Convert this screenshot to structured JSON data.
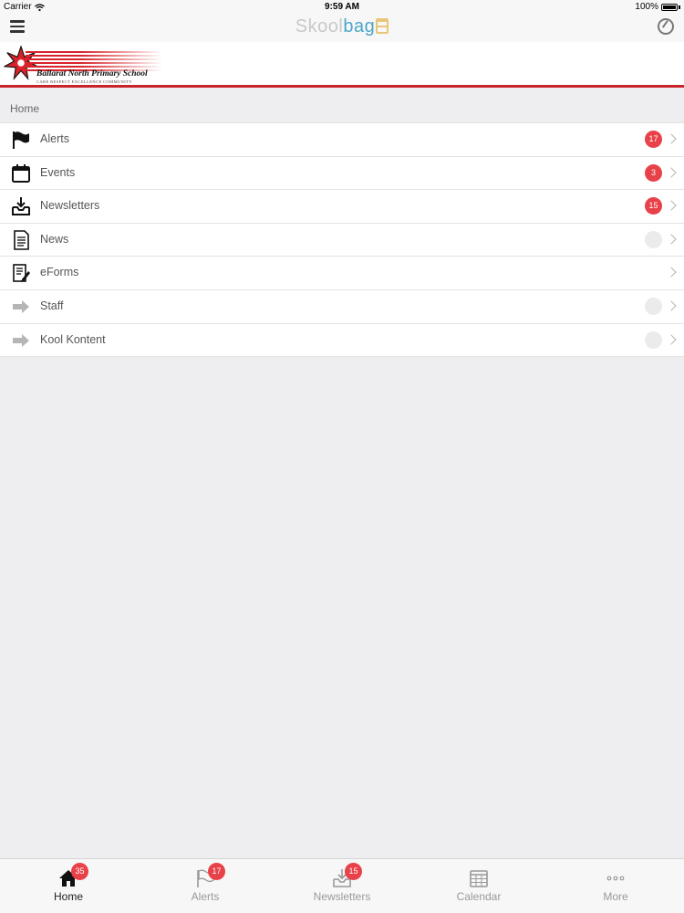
{
  "status_bar": {
    "carrier": "Carrier",
    "time": "9:59 AM",
    "battery": "100%"
  },
  "app": {
    "logo_part1": "Skool",
    "logo_part2": "bag"
  },
  "school": {
    "name": "Ballarat North Primary School",
    "motto": "CARE RESPECT EXCELLENCE COMMUNITY"
  },
  "breadcrumb": "Home",
  "menu": [
    {
      "label": "Alerts",
      "icon": "flag-icon",
      "badge": "17"
    },
    {
      "label": "Events",
      "icon": "calendar-icon",
      "badge": "3"
    },
    {
      "label": "Newsletters",
      "icon": "inbox-download-icon",
      "badge": "15"
    },
    {
      "label": "News",
      "icon": "document-icon",
      "badge": ""
    },
    {
      "label": "eForms",
      "icon": "form-edit-icon"
    },
    {
      "label": "Staff",
      "icon": "arrow-right-icon",
      "badge": ""
    },
    {
      "label": "Kool Kontent",
      "icon": "arrow-right-icon",
      "badge": ""
    }
  ],
  "tabs": [
    {
      "label": "Home",
      "icon": "home-icon",
      "badge": "35",
      "active": true
    },
    {
      "label": "Alerts",
      "icon": "flag-icon",
      "badge": "17"
    },
    {
      "label": "Newsletters",
      "icon": "inbox-download-icon",
      "badge": "15"
    },
    {
      "label": "Calendar",
      "icon": "calendar-icon"
    },
    {
      "label": "More",
      "icon": "more-dots-icon"
    }
  ],
  "colors": {
    "badge_red": "#e84149",
    "brand_red": "#c9242b",
    "logo_blue": "#4aa6c8"
  }
}
